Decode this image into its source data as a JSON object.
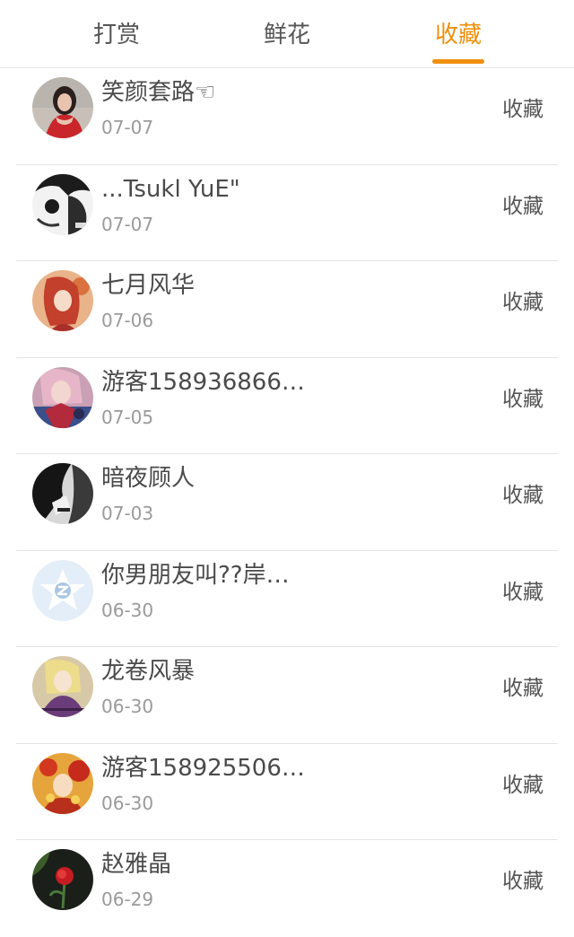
{
  "tabs": [
    {
      "label": "打赏",
      "active": false
    },
    {
      "label": "鲜花",
      "active": false
    },
    {
      "label": "收藏",
      "active": true
    }
  ],
  "colors": {
    "accent": "#f0900e",
    "text": "#4a4a4a",
    "subtext": "#9a9a9a",
    "divider": "#e4e4e4"
  },
  "items": [
    {
      "name": "笑颜套路☜",
      "date": "07-07",
      "action": "收藏",
      "avatar": "avatar-girl-red-dress"
    },
    {
      "name": "...Tsukl YuE\"",
      "date": "07-07",
      "action": "收藏",
      "avatar": "avatar-monochrome-sketch"
    },
    {
      "name": "七月风华",
      "date": "07-06",
      "action": "收藏",
      "avatar": "avatar-anime-red-hair"
    },
    {
      "name": "游客158936866…",
      "date": "07-05",
      "action": "收藏",
      "avatar": "avatar-colorful-portrait"
    },
    {
      "name": "暗夜顾人",
      "date": "07-03",
      "action": "收藏",
      "avatar": "avatar-dark-hooded"
    },
    {
      "name": "你男朋友叫??岸…",
      "date": "06-30",
      "action": "收藏",
      "avatar": "avatar-default-star"
    },
    {
      "name": "龙卷风暴",
      "date": "06-30",
      "action": "收藏",
      "avatar": "avatar-anime-blonde"
    },
    {
      "name": "游客158925506…",
      "date": "06-30",
      "action": "收藏",
      "avatar": "avatar-anime-fire"
    },
    {
      "name": "赵雅晶",
      "date": "06-29",
      "action": "收藏",
      "avatar": "avatar-red-rose"
    }
  ]
}
